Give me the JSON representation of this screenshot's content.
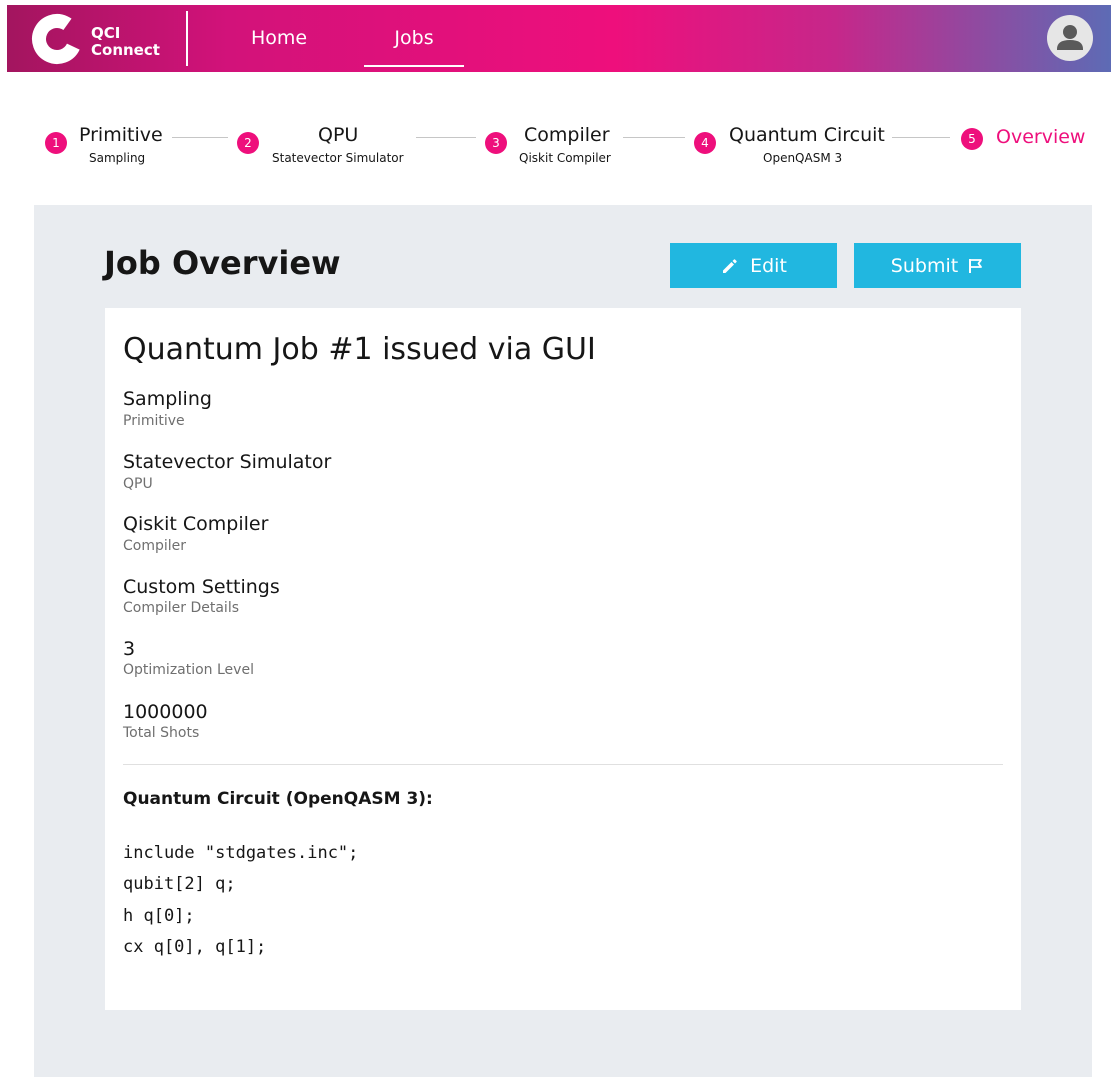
{
  "header": {
    "logo_line1": "QCI",
    "logo_line2": "Connect",
    "nav": [
      {
        "label": "Home",
        "active": false
      },
      {
        "label": "Jobs",
        "active": true
      }
    ],
    "avatar_icon": "user-icon",
    "gradient_colors": [
      "#a3155f",
      "#ee0f7c",
      "#5d6bb5"
    ]
  },
  "stepper": {
    "accent_color": "#ee0f7c",
    "steps": [
      {
        "num": "1",
        "title": "Primitive",
        "sub": "Sampling"
      },
      {
        "num": "2",
        "title": "QPU",
        "sub": "Statevector Simulator"
      },
      {
        "num": "3",
        "title": "Compiler",
        "sub": "Qiskit Compiler"
      },
      {
        "num": "4",
        "title": "Quantum Circuit",
        "sub": "OpenQASM 3"
      },
      {
        "num": "5",
        "title": "Overview",
        "sub": ""
      }
    ],
    "active_step": "5"
  },
  "page": {
    "title": "Job Overview",
    "edit_label": "Edit",
    "edit_icon": "pencil-icon",
    "submit_label": "Submit",
    "submit_icon": "flag-icon",
    "button_color": "#21b7e0"
  },
  "job": {
    "title": "Quantum Job #1 issued via GUI",
    "fields": [
      {
        "value": "Sampling",
        "label": "Primitive"
      },
      {
        "value": "Statevector Simulator",
        "label": "QPU"
      },
      {
        "value": "Qiskit Compiler",
        "label": "Compiler"
      },
      {
        "value": "Custom Settings",
        "label": "Compiler Details"
      },
      {
        "value": "3",
        "label": "Optimization Level"
      },
      {
        "value": "1000000",
        "label": "Total Shots"
      }
    ],
    "circuit_heading": "Quantum Circuit (OpenQASM 3):",
    "code": [
      "include \"stdgates.inc\";",
      "qubit[2] q;",
      "h q[0];",
      "cx q[0], q[1];"
    ]
  }
}
